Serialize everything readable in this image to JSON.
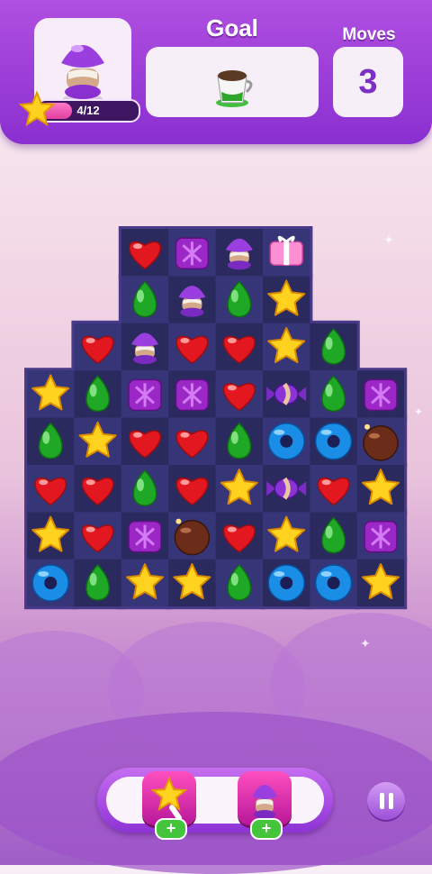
{
  "header": {
    "level_progress_text": "4/12",
    "level_progress_fraction": 0.33,
    "goal_label": "Goal",
    "moves_label": "Moves",
    "moves_value": "3",
    "goal_icon": "coffee-cup-icon"
  },
  "colors": {
    "accent_purple": "#8a2fd0",
    "progress_pink": "#e0409f",
    "board_dark": "#2b2a5e",
    "board_light": "#363577"
  },
  "board": {
    "rows": [
      [
        null,
        null,
        "heart",
        "cube",
        "bomb-purple",
        "gift",
        null,
        null
      ],
      [
        null,
        null,
        "drop",
        "bomb-purple",
        "drop",
        "star",
        null,
        null
      ],
      [
        null,
        "heart",
        "bomb-purple",
        "heart",
        "heart",
        "star",
        "drop",
        null
      ],
      [
        "star",
        "drop",
        "cube",
        "cube",
        "heart",
        "wrapped",
        "drop",
        "cube"
      ],
      [
        "drop",
        "star",
        "heart",
        "heart",
        "drop",
        "ring",
        "ring",
        "chocolate-bomb"
      ],
      [
        "heart",
        "heart",
        "drop",
        "heart",
        "star",
        "wrapped",
        "heart",
        "star"
      ],
      [
        "star",
        "heart",
        "cube",
        "chocolate-bomb",
        "heart",
        "star",
        "drop",
        "cube"
      ],
      [
        "ring",
        "drop",
        "star",
        "star",
        "drop",
        "ring",
        "ring",
        "star"
      ]
    ]
  },
  "boosters": [
    {
      "name": "magic-wand-star-icon",
      "add_label": "+"
    },
    {
      "name": "purple-bomb-icon",
      "add_label": "+"
    }
  ]
}
